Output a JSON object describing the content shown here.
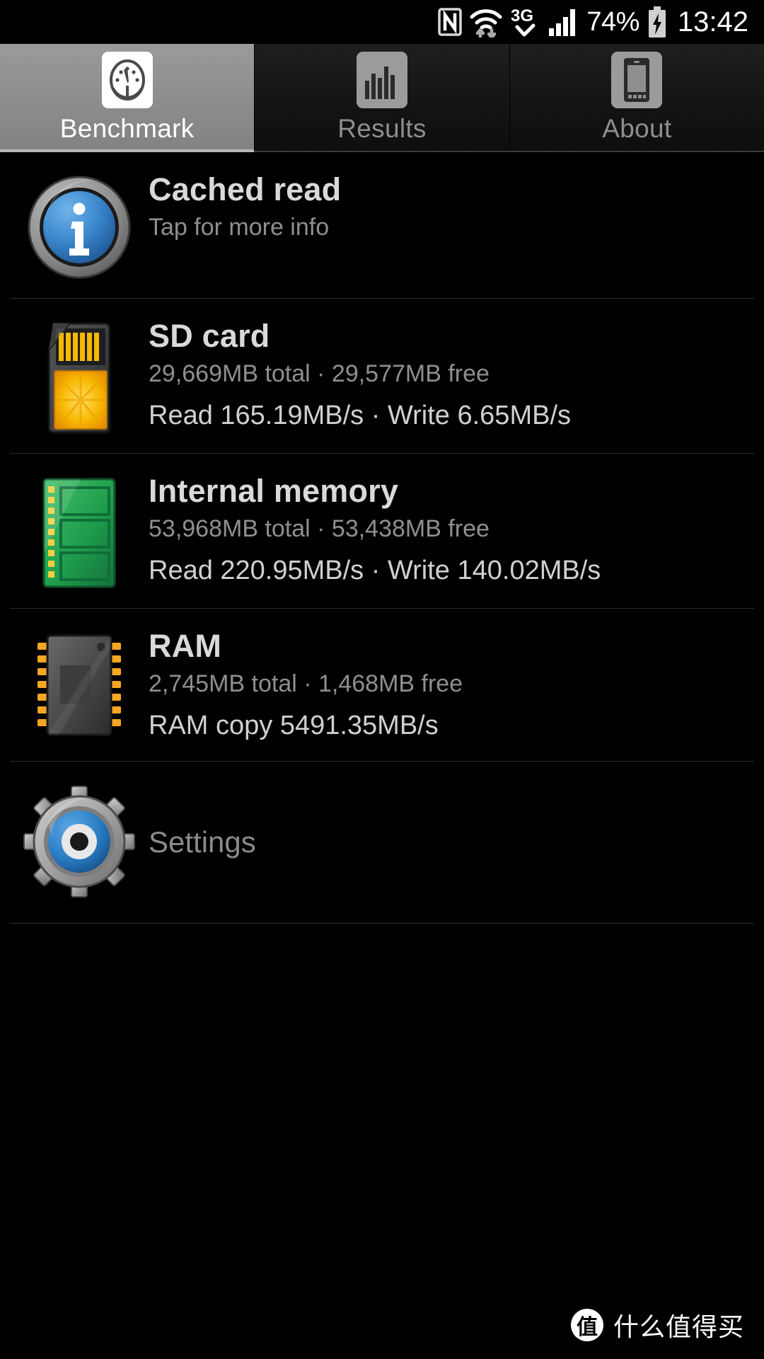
{
  "statusbar": {
    "nfc_icon": "nfc-icon",
    "wifi_icon": "wifi-icon",
    "data_transfer_icon": "data-transfer-arrows-icon",
    "network_type": "3G",
    "signal_icon": "cellular-signal-icon",
    "battery_percent": "74%",
    "battery_icon": "battery-charging-icon",
    "clock": "13:42"
  },
  "tabs": [
    {
      "label": "Benchmark",
      "icon": "speedometer-icon",
      "active": true
    },
    {
      "label": "Results",
      "icon": "bar-chart-icon",
      "active": false
    },
    {
      "label": "About",
      "icon": "phone-device-icon",
      "active": false
    }
  ],
  "rows": [
    {
      "icon": "info-circle-icon",
      "title": "Cached read",
      "subtitle": "Tap for more info",
      "speed": ""
    },
    {
      "icon": "sd-card-icon",
      "title": "SD card",
      "subtitle": "29,669MB total · 29,577MB free",
      "speed": "Read 165.19MB/s · Write 6.65MB/s"
    },
    {
      "icon": "memory-module-icon",
      "title": "Internal memory",
      "subtitle": "53,968MB total · 53,438MB free",
      "speed": "Read 220.95MB/s · Write 140.02MB/s"
    },
    {
      "icon": "ram-chip-icon",
      "title": "RAM",
      "subtitle": "2,745MB total · 1,468MB free",
      "speed": "RAM copy 5491.35MB/s"
    }
  ],
  "settings": {
    "icon": "gear-eye-icon",
    "label": "Settings"
  },
  "watermark": {
    "badge": "值",
    "text": "什么值得买"
  },
  "colors": {
    "background": "#000000",
    "tab_active_bg": "#8e8e8e",
    "title_text": "#d9d9d9",
    "subtitle_text": "#8f8f8f",
    "speed_text": "#d0d0d0",
    "accent_blue": "#2d7fd0",
    "sd_yellow": "#f5b800",
    "memory_green": "#2f9e44"
  }
}
